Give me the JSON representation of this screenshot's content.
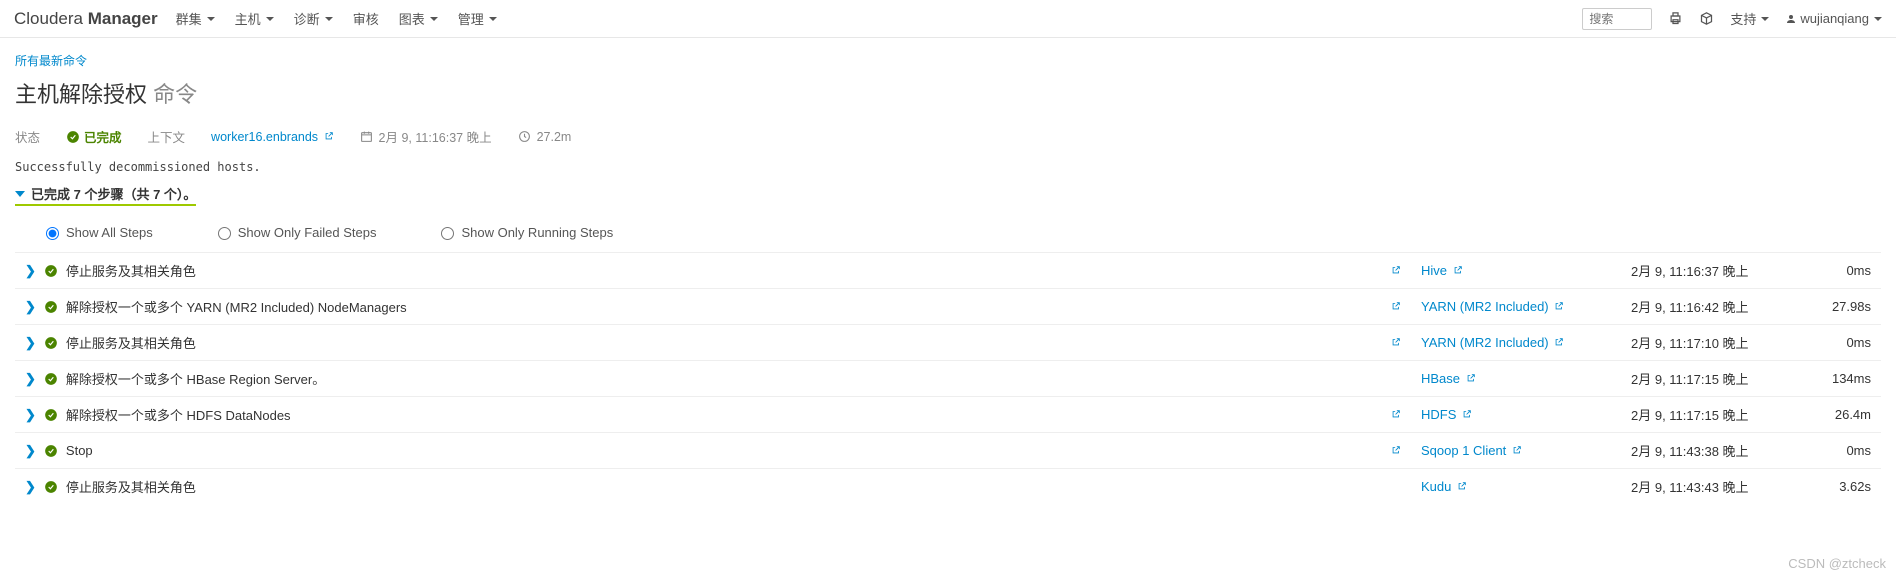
{
  "brand": {
    "light": "Cloudera ",
    "bold": "Manager"
  },
  "nav": {
    "items": [
      "群集",
      "主机",
      "诊断",
      "审核",
      "图表",
      "管理"
    ],
    "support": "支持",
    "user": "wujianqiang"
  },
  "search": {
    "placeholder": "搜索"
  },
  "breadcrumb": "所有最新命令",
  "title": {
    "main": "主机解除授权",
    "sub": " 命令"
  },
  "info": {
    "state_label": "状态",
    "state_value": "已完成",
    "context_label": "上下文",
    "context_value": "worker16.enbrands",
    "time_value": "2月 9, 11:16:37 晚上",
    "duration_value": "27.2m"
  },
  "message": "Successfully decommissioned hosts.",
  "steps_summary": "已完成 7 个步骤（共 7 个）。",
  "filters": {
    "all": "Show All Steps",
    "failed": "Show Only Failed Steps",
    "running": "Show Only Running Steps"
  },
  "steps": [
    {
      "name": "停止服务及其相关角色",
      "ext": true,
      "service": "Hive",
      "svc_ext": true,
      "time": "2月 9, 11:16:37 晚上",
      "dur": "0ms"
    },
    {
      "name": "解除授权一个或多个 YARN (MR2 Included) NodeManagers",
      "ext": true,
      "service": "YARN (MR2 Included)",
      "svc_ext": true,
      "time": "2月 9, 11:16:42 晚上",
      "dur": "27.98s"
    },
    {
      "name": "停止服务及其相关角色",
      "ext": true,
      "service": "YARN (MR2 Included)",
      "svc_ext": true,
      "time": "2月 9, 11:17:10 晚上",
      "dur": "0ms"
    },
    {
      "name": "解除授权一个或多个 HBase Region Server。",
      "ext": false,
      "service": "HBase",
      "svc_ext": true,
      "time": "2月 9, 11:17:15 晚上",
      "dur": "134ms"
    },
    {
      "name": "解除授权一个或多个 HDFS DataNodes",
      "ext": true,
      "service": "HDFS",
      "svc_ext": true,
      "time": "2月 9, 11:17:15 晚上",
      "dur": "26.4m"
    },
    {
      "name": "Stop",
      "ext": true,
      "service": "Sqoop 1 Client",
      "svc_ext": true,
      "time": "2月 9, 11:43:38 晚上",
      "dur": "0ms"
    },
    {
      "name": "停止服务及其相关角色",
      "ext": false,
      "service": "Kudu",
      "svc_ext": true,
      "time": "2月 9, 11:43:43 晚上",
      "dur": "3.62s"
    }
  ],
  "watermark": "CSDN @ztcheck"
}
